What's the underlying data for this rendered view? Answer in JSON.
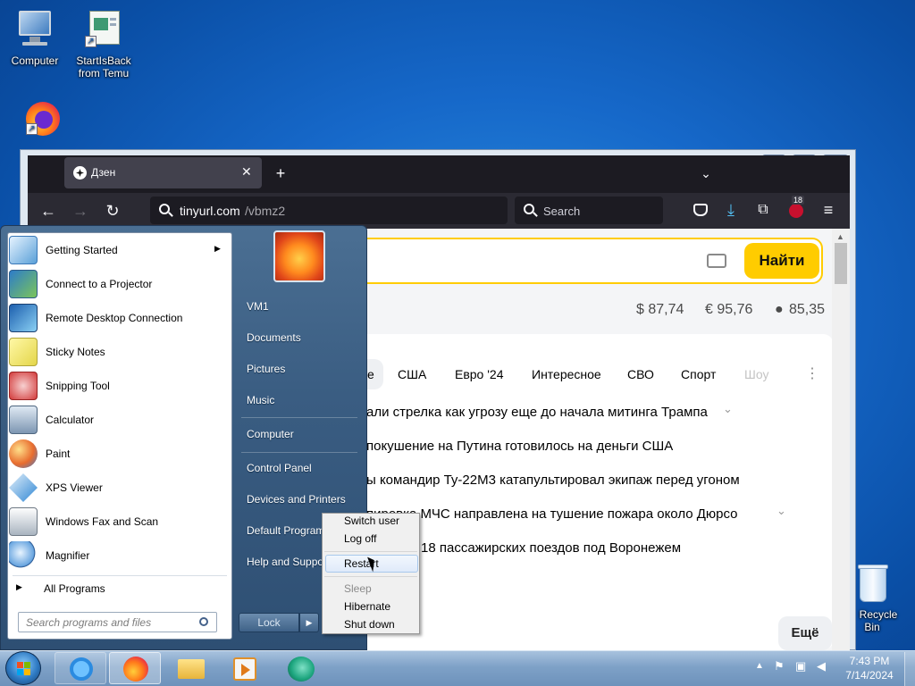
{
  "desktop": {
    "icons": [
      {
        "label": "Computer"
      },
      {
        "label": "StartIsBack from Temu"
      },
      {
        "label": "Recycle Bin"
      }
    ]
  },
  "browser": {
    "tab_title": "Дзен",
    "url_host": "tinyurl.com",
    "url_path": "/vbmz2",
    "search_placeholder": "Search",
    "extension_badge": "18",
    "page": {
      "search_button": "Найти",
      "rates": [
        "$ 87,74",
        "€ 95,76",
        "85,35"
      ],
      "tabs": [
        "США",
        "Евро '24",
        "Интересное",
        "СВО",
        "Спорт",
        "Шоу"
      ],
      "partial_tab": "е",
      "headlines": [
        "али стрелка как угрозу еще до начала митинга Трампа",
        "покушение на Путина готовилось на деньги США",
        "ы командир Ту-22М3 катапультировал экипаж перед угоном",
        "пировка МЧС направлена на тушение пожара около Дюрсо",
        "18 пассажирских поездов под Воронежем"
      ],
      "more_button": "Ещё"
    }
  },
  "start_menu": {
    "programs": [
      {
        "label": "Getting Started",
        "has_submenu": true
      },
      {
        "label": "Connect to a Projector"
      },
      {
        "label": "Remote Desktop Connection"
      },
      {
        "label": "Sticky Notes"
      },
      {
        "label": "Snipping Tool"
      },
      {
        "label": "Calculator"
      },
      {
        "label": "Paint"
      },
      {
        "label": "XPS Viewer"
      },
      {
        "label": "Windows Fax and Scan"
      },
      {
        "label": "Magnifier"
      }
    ],
    "all_programs": "All Programs",
    "search_placeholder": "Search programs and files",
    "right_links": {
      "user": "VM1",
      "documents": "Documents",
      "pictures": "Pictures",
      "music": "Music",
      "computer": "Computer",
      "control_panel": "Control Panel",
      "devices": "Devices and Printers",
      "default_programs": "Default Programs",
      "help": "Help and Support"
    },
    "lock_button": "Lock",
    "power_menu": {
      "switch_user": "Switch user",
      "log_off": "Log off",
      "restart": "Restart",
      "sleep": "Sleep",
      "hibernate": "Hibernate",
      "shut_down": "Shut down"
    }
  },
  "taskbar": {
    "time": "7:43 PM",
    "date": "7/14/2024"
  }
}
